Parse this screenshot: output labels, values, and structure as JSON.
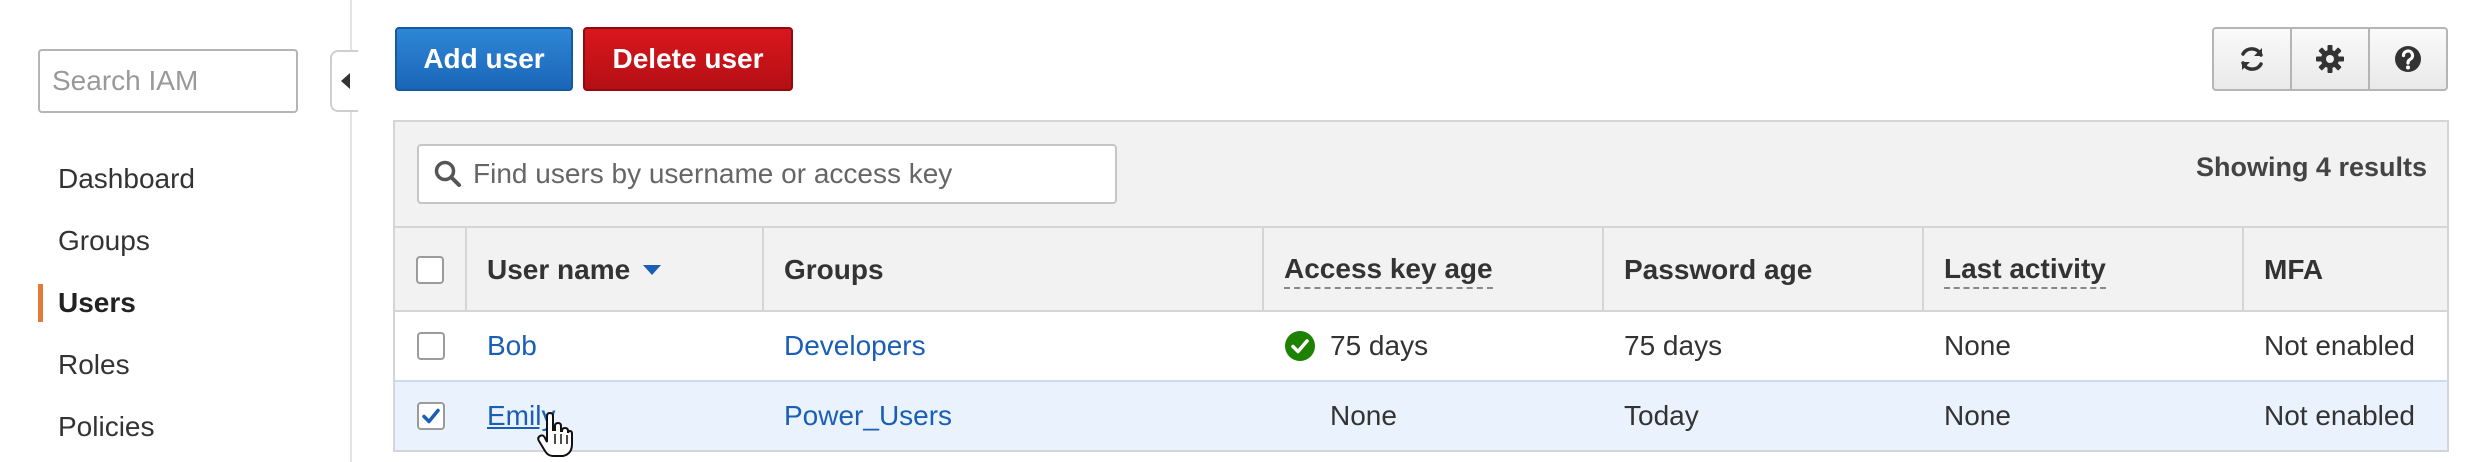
{
  "sidebar": {
    "search_placeholder": "Search IAM",
    "items": [
      {
        "label": "Dashboard"
      },
      {
        "label": "Groups"
      },
      {
        "label": "Users"
      },
      {
        "label": "Roles"
      },
      {
        "label": "Policies"
      }
    ],
    "active_item": "Users",
    "accent_color": "#e07b39"
  },
  "toolbar": {
    "add_label": "Add user",
    "delete_label": "Delete user",
    "icons": [
      "refresh-icon",
      "gear-icon",
      "help-icon"
    ]
  },
  "table": {
    "search_placeholder": "Find users by username or access key",
    "results_text": "Showing 4 results",
    "columns": [
      "User name",
      "Groups",
      "Access key age",
      "Password age",
      "Last activity",
      "MFA"
    ],
    "sort_column": "User name",
    "rows": [
      {
        "username": "Bob",
        "groups": "Developers",
        "access_key_age": "75 days",
        "access_key_status": "check-circle-icon",
        "password_age": "75 days",
        "last_activity": "None",
        "mfa": "Not enabled",
        "selected": false
      },
      {
        "username": "Emily",
        "groups": "Power_Users",
        "access_key_age": "None",
        "password_age": "Today",
        "last_activity": "None",
        "mfa": "Not enabled",
        "selected": true
      }
    ]
  },
  "colors": {
    "primary": "#1a66b8",
    "danger": "#c21318",
    "link": "#1a5eb5",
    "success": "#1d8102",
    "selected_row": "#eaf3fd"
  }
}
